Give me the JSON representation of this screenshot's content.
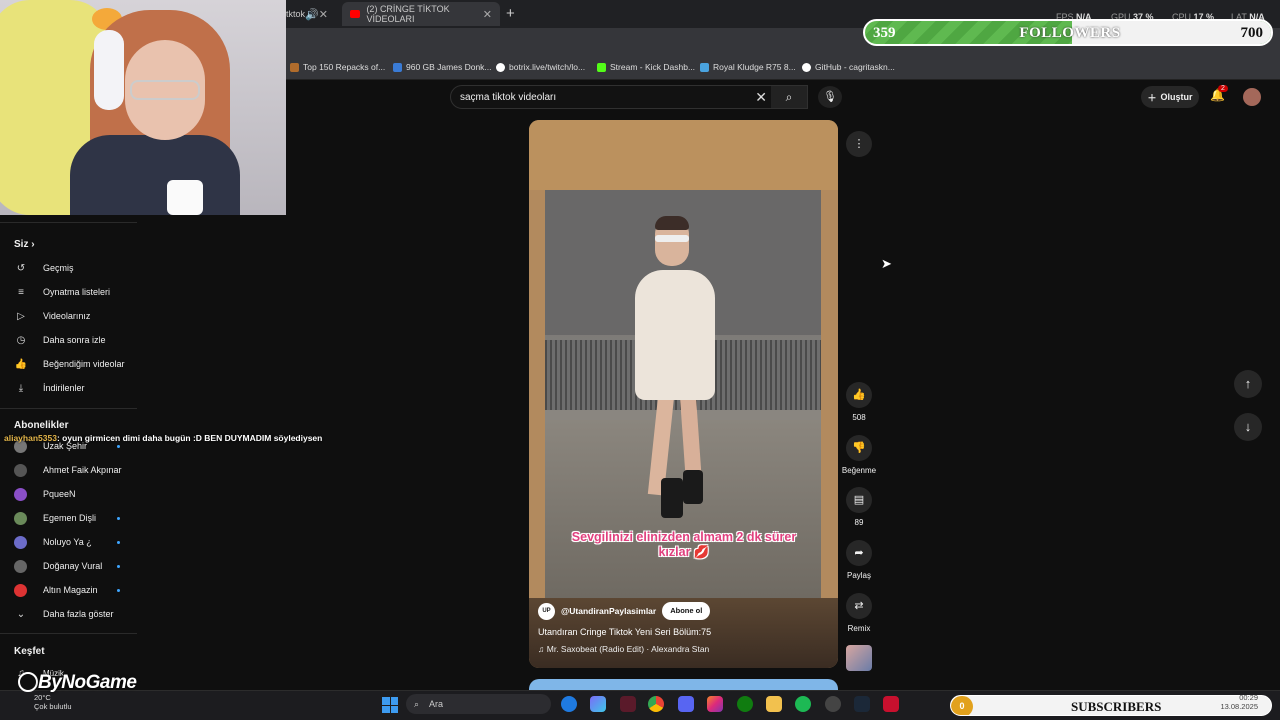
{
  "browser": {
    "tab_inactive": "tktok",
    "tab_active": "(2) CRİNGE TİKTOK VİDEOLARI",
    "new_tab": "+",
    "bookmarks": [
      {
        "label": "Top 150 Repacks of...",
        "color": "#b06c2c"
      },
      {
        "label": "960 GB James Donk...",
        "color": "#3a7bd5"
      },
      {
        "label": "botrix.live/twitch/lo...",
        "color": "#ffffff"
      },
      {
        "label": "Stream - Kick Dashb...",
        "color": "#53fc18"
      },
      {
        "label": "Royal Kludge R75 8...",
        "color": "#4aa3df"
      },
      {
        "label": "GitHub - cagritaskn...",
        "color": "#ffffff"
      }
    ],
    "stats": [
      {
        "k": "FPS",
        "v": "N/A"
      },
      {
        "k": "GPU",
        "v": "37 %"
      },
      {
        "k": "CPU",
        "v": "17 %"
      },
      {
        "k": "LAT",
        "v": "N/A"
      }
    ]
  },
  "overlay": {
    "followers_count": "359",
    "followers_label": "FOLLOWERS",
    "followers_goal": "700",
    "followers_progress": 0.51,
    "chat_user": "aliayhan5353",
    "chat_text": ": oyun girmicen dimi daha bugün :D BEN DUYMADIM söylediysen",
    "sponsor": "ByNoGame",
    "subs_count": "0",
    "subs_label": "SUBSCRIBERS",
    "accent": "#5fb950"
  },
  "header": {
    "search_value": "saçma tiktok videoları",
    "create_label": "Oluştur",
    "notif_count": "2"
  },
  "sidebar": {
    "you_label": "Siz",
    "you_items": [
      {
        "label": "Geçmiş",
        "icon": "history-icon"
      },
      {
        "label": "Oynatma listeleri",
        "icon": "playlist-icon"
      },
      {
        "label": "Videolarınız",
        "icon": "video-icon"
      },
      {
        "label": "Daha sonra izle",
        "icon": "clock-icon"
      },
      {
        "label": "Beğendiğim videolar",
        "icon": "thumbs-up-icon"
      },
      {
        "label": "İndirilenler",
        "icon": "download-icon"
      }
    ],
    "subs_label": "Abonelikler",
    "subs": [
      {
        "label": "Uzak Şehir",
        "color": "#777",
        "dot": true
      },
      {
        "label": "Ahmet Faik Akpınar",
        "color": "#555",
        "dot": false
      },
      {
        "label": "PqueeN",
        "color": "#8a4fc7",
        "dot": false
      },
      {
        "label": "Egemen Dişli",
        "color": "#6a8a5a",
        "dot": true
      },
      {
        "label": "Noluyo Ya ¿",
        "color": "#6c6cc9",
        "dot": true
      },
      {
        "label": "Doğanay Vural",
        "color": "#666",
        "dot": true
      },
      {
        "label": "Altın Magazin",
        "color": "#d33",
        "dot": true
      }
    ],
    "show_more": "Daha fazla göster",
    "explore_label": "Keşfet",
    "music_label": "Müzik"
  },
  "short": {
    "channel_initials": "UP",
    "channel": "@UtandiranPaylasimlar",
    "subscribe": "Abone ol",
    "title": "Utandıran Cringe Tiktok Yeni Seri Bölüm:75",
    "music": "Mr. Saxobeat (Radio Edit) · Alexandra Stan",
    "caption": "Sevgilinizi elinizden almam 2 dk sürer kızlar 💋"
  },
  "actions": {
    "likes": "508",
    "dislike": "Beğenme",
    "comments": "89",
    "share": "Paylaş",
    "remix": "Remix"
  },
  "taskbar": {
    "search": "Ara",
    "temp": "20°C",
    "weather": "Çok bulutlu",
    "time": "00:29",
    "date": "13.08.2025"
  }
}
